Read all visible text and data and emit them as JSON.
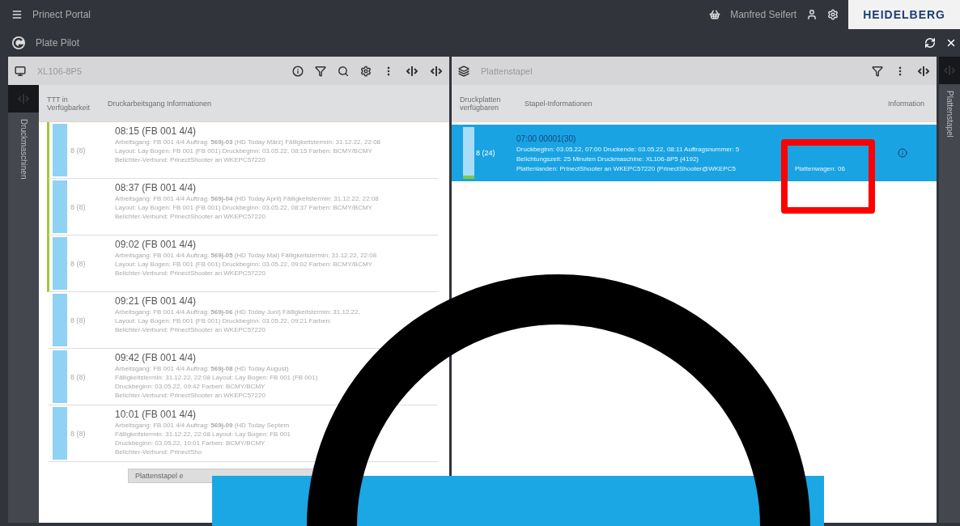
{
  "app_bar": {
    "title": "Prinect Portal",
    "user": "Manfred Seifert",
    "brand": "HEIDELBERG"
  },
  "sub_bar": {
    "title": "Plate Pilot"
  },
  "left_rail": {
    "label": "Druckmaschinen"
  },
  "press_panel": {
    "title": "XL106-8P5",
    "columns": [
      "TTT in Verfügbarkeit",
      "Druckarbeitsgang Informationen"
    ],
    "button": "Plattenstapel e",
    "rows": [
      {
        "ready": true,
        "count": "8 (8)",
        "time": "08:15 (FB 001 4/4)",
        "lines": [
          "Arbeitsgang: FB 001 4/4 Auftrag: **569j-03** (HD Today März) Fälligkeitstermin: 31.12.22, 22:08",
          "Layout: Lay Bogen: FB 001 (FB 001) Druckbeginn: 03.05.22, 08:15 Farben: BCMY/BCMY",
          "Belichter-Verbund: PrinectShooter an WKEPC57220"
        ]
      },
      {
        "ready": true,
        "count": "8 (8)",
        "time": "08:37 (FB 001 4/4)",
        "lines": [
          "Arbeitsgang: FB 001 4/4 Auftrag: **569j-04** (HD Today April) Fälligkeitstermin: 31.12.22, 22:08",
          "Layout: Lay Bogen: FB 001 (FB 001) Druckbeginn: 03.05.22, 08:37 Farben: BCMY/BCMY",
          "Belichter-Verbund: PrinectShooter an WKEPC57220"
        ]
      },
      {
        "ready": true,
        "count": "8 (8)",
        "time": "09:02 (FB 001 4/4)",
        "lines": [
          "Arbeitsgang: FB 001 4/4 Auftrag: **569j-05** (HD Today Mai) Fälligkeitstermin: 31.12.22, 22:08",
          "Layout: Lay Bogen: FB 001 (FB 001) Druckbeginn: 03.05.22, 09:02 Farben: BCMY/BCMY",
          "Belichter-Verbund: PrinectShooter an WKEPC57220"
        ]
      },
      {
        "ready": false,
        "count": "8 (8)",
        "time": "09:21 (FB 001 4/4)",
        "lines": [
          "Arbeitsgang: FB 001 4/4 Auftrag: **569j-06** (HD Today Juni) Fälligkeitstermin: 31.12.22,",
          "Layout: Lay Bogen: FB 001 (FB 001) Druckbeginn: 03.05.22, 09:21 Farben:",
          "Belichter-Verbund: PrinectShooter an WKEPC57220"
        ]
      },
      {
        "ready": false,
        "count": "8 (8)",
        "time": "09:42 (FB 001 4/4)",
        "lines": [
          "Arbeitsgang: FB 001 4/4 Auftrag: **569j-08** (HD Today August)",
          "Fälligkeitstermin: 31.12.22, 22:08 Layout: Lay Bogen: FB 001 (FB 001)",
          "Druckbeginn: 03.05.22, 09:42 Farben: BCMY/BCMY",
          "Belichter-Verbund: PrinectShooter an WKEPC57220"
        ]
      },
      {
        "ready": false,
        "count": "8 (8)",
        "time": "10:01 (FB 001 4/4)",
        "lines": [
          "Arbeitsgang: FB 001 4/4 Auftrag: **569j-09** (HD Today Septem",
          "Fälligkeitstermin: 31.12.22, 22:08 Layout: Lay Bogen: FB 001",
          "Druckbeginn: 03.05.22, 10:01 Farben: BCMY/BCMY",
          "Belichter-Verbund: PrinectSho"
        ]
      }
    ]
  },
  "stack_panel": {
    "title": "Plattenstapel",
    "columns": [
      "Druckplatten verfügbaren",
      "Stapel-Informationen",
      "Information"
    ],
    "rows": [
      {
        "selected": true,
        "count": "8 (24)",
        "title": "07:00 00001(30)",
        "lines": [
          "Druckbeginn: 03.05.22, 07:00 Druckende: 03.05.22, 08:11 Auftragsnummer: 5",
          "Belichtungszeit: 25 Minuten Druckmaschine: XL106-8P5 (4192)",
          "Plattenlanden: PrinectShooter an WKEPC57220 (PrinectShooter@WKEPC5"
        ],
        "cart": "Plattenwagen: 06"
      }
    ]
  },
  "right_rail": {
    "label": "Plattenstapel"
  }
}
